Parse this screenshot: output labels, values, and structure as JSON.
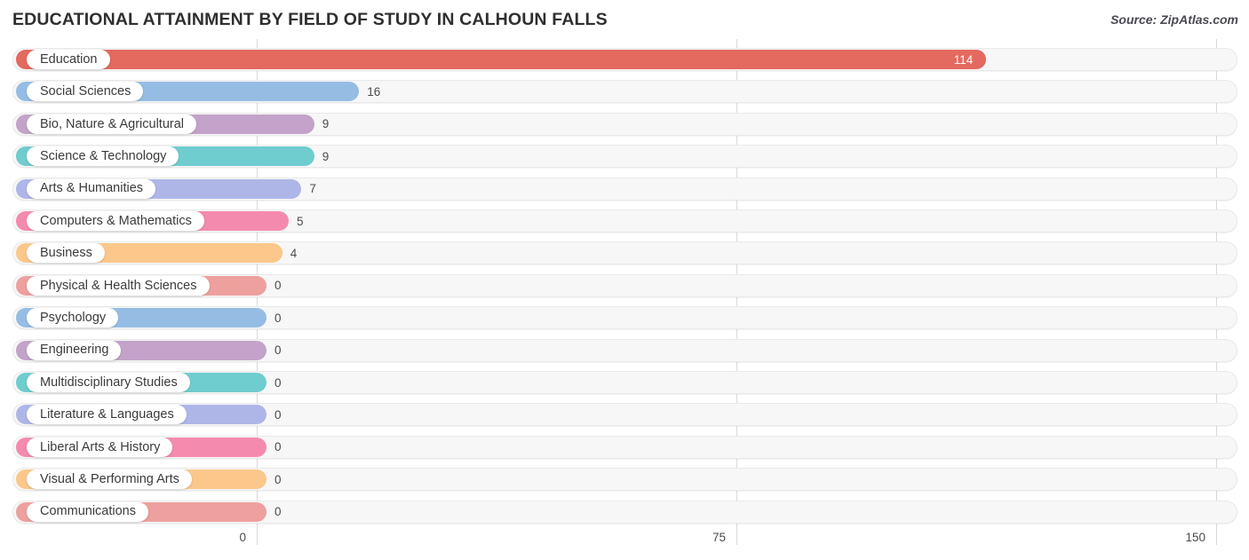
{
  "header": {
    "title": "EDUCATIONAL ATTAINMENT BY FIELD OF STUDY IN CALHOUN FALLS",
    "source": "Source: ZipAtlas.com"
  },
  "chart_data": {
    "type": "bar",
    "orientation": "horizontal",
    "title": "EDUCATIONAL ATTAINMENT BY FIELD OF STUDY IN CALHOUN FALLS",
    "xlabel": "",
    "ylabel": "",
    "xlim": [
      0,
      150
    ],
    "xticks": [
      0,
      75,
      150
    ],
    "xtick_labels": [
      "0",
      "75",
      "150"
    ],
    "grid": true,
    "legend": false,
    "categories": [
      "Education",
      "Social Sciences",
      "Bio, Nature & Agricultural",
      "Science & Technology",
      "Arts & Humanities",
      "Computers & Mathematics",
      "Business",
      "Physical & Health Sciences",
      "Psychology",
      "Engineering",
      "Multidisciplinary Studies",
      "Literature & Languages",
      "Liberal Arts & History",
      "Visual & Performing Arts",
      "Communications"
    ],
    "values": [
      114,
      16,
      9,
      9,
      7,
      5,
      4,
      0,
      0,
      0,
      0,
      0,
      0,
      0,
      0
    ],
    "value_labels": [
      "114",
      "16",
      "9",
      "9",
      "7",
      "5",
      "4",
      "0",
      "0",
      "0",
      "0",
      "0",
      "0",
      "0",
      "0"
    ],
    "colors": [
      "#e4695f",
      "#95bde4",
      "#c3a3c9",
      "#6fcccf",
      "#aeb6e8",
      "#f58aaf",
      "#fbc78b",
      "#eda09e",
      "#95bde4",
      "#c3a3c9",
      "#6fcccf",
      "#aeb6e8",
      "#f58aaf",
      "#fbc78b",
      "#eda09e"
    ]
  }
}
